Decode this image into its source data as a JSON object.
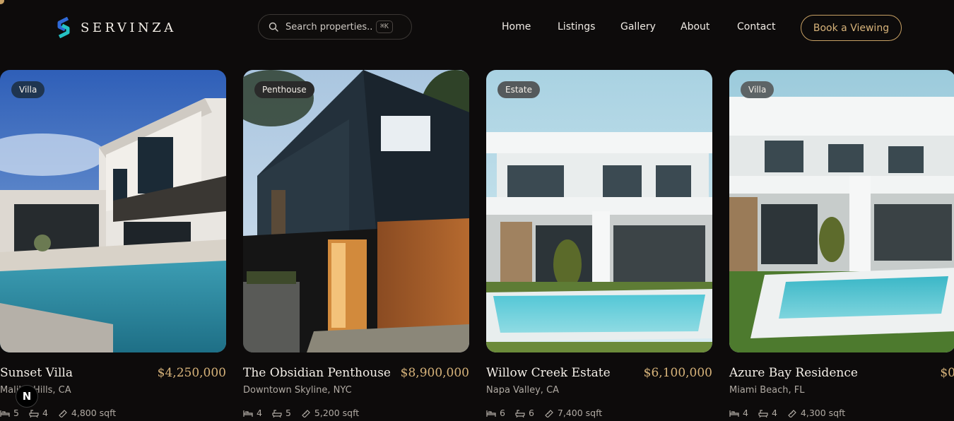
{
  "brand": {
    "name": "SERVINZA",
    "colors": {
      "accent": "#c7a064",
      "background": "#0d0b0b"
    }
  },
  "search": {
    "placeholder": "Search properties...",
    "shortcut": "⌘K"
  },
  "nav": {
    "items": [
      "Home",
      "Listings",
      "Gallery",
      "About",
      "Contact"
    ]
  },
  "cta": {
    "label": "Book a Viewing"
  },
  "listings": [
    {
      "badge": "Villa",
      "title": "Sunset Villa",
      "price": "$4,250,000",
      "location": "Malibu Hills, CA",
      "beds": "5",
      "baths": "4",
      "area": "4,800 sqft"
    },
    {
      "badge": "Penthouse",
      "title": "The Obsidian Penthouse",
      "price": "$8,900,000",
      "location": "Downtown Skyline, NYC",
      "beds": "4",
      "baths": "5",
      "area": "5,200 sqft"
    },
    {
      "badge": "Estate",
      "title": "Willow Creek Estate",
      "price": "$6,100,000",
      "location": "Napa Valley, CA",
      "beds": "6",
      "baths": "6",
      "area": "7,400 sqft"
    },
    {
      "badge": "Villa",
      "title": "Azure Bay Residence",
      "price": "$0",
      "location": "Miami Beach, FL",
      "beds": "4",
      "baths": "4",
      "area": "4,300 sqft"
    }
  ],
  "icons": {
    "bed": "bed-icon",
    "bath": "bath-icon",
    "area": "ruler-icon",
    "search": "search-icon"
  },
  "dev_badge": {
    "label": "N"
  }
}
